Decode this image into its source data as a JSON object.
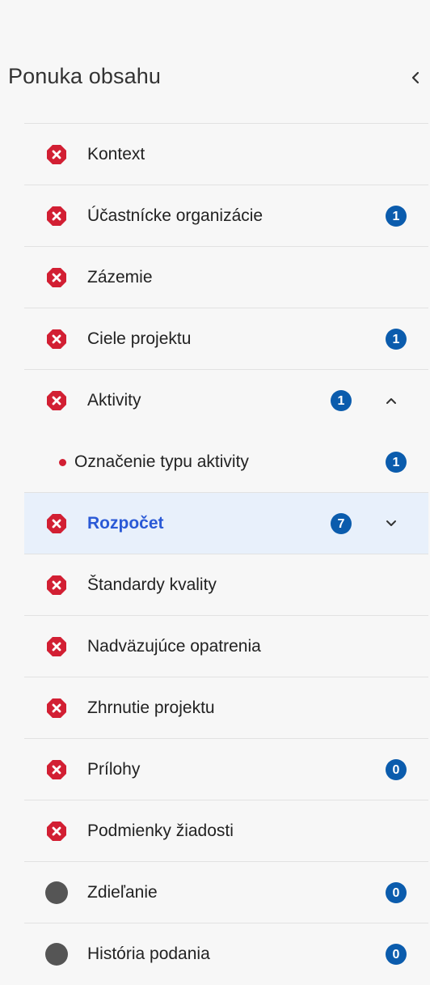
{
  "header": {
    "title": "Ponuka obsahu"
  },
  "colors": {
    "error": "#d21f33",
    "badge": "#0b5cad",
    "active_text": "#2a59d6",
    "active_bg": "#e8f0fb",
    "neutral_status": "#555555"
  },
  "nav": {
    "items": [
      {
        "label": "Kontext",
        "status": "error-icon",
        "badge": ""
      },
      {
        "label": "Účastnícke organizácie",
        "status": "error-icon",
        "badge": "1"
      },
      {
        "label": "Zázemie",
        "status": "error-icon",
        "badge": ""
      },
      {
        "label": "Ciele projektu",
        "status": "error-icon",
        "badge": "1"
      },
      {
        "label": "Aktivity",
        "status": "error-icon",
        "badge": "1",
        "chevron": "chevron-up-icon"
      },
      {
        "label": "Označenie typu aktivity",
        "status": "error-dot",
        "badge": "1"
      },
      {
        "label": "Rozpočet",
        "status": "error-icon",
        "badge": "7",
        "chevron": "chevron-down-icon",
        "active": true
      },
      {
        "label": "Štandardy kvality",
        "status": "error-icon",
        "badge": ""
      },
      {
        "label": "Nadväzujúce opatrenia",
        "status": "error-icon",
        "badge": ""
      },
      {
        "label": "Zhrnutie projektu",
        "status": "error-icon",
        "badge": ""
      },
      {
        "label": "Prílohy",
        "status": "error-icon",
        "badge": "0"
      },
      {
        "label": "Podmienky žiadosti",
        "status": "error-icon",
        "badge": ""
      },
      {
        "label": "Zdieľanie",
        "status": "neutral-dot",
        "badge": "0"
      },
      {
        "label": "História podania",
        "status": "neutral-dot",
        "badge": "0"
      }
    ]
  }
}
